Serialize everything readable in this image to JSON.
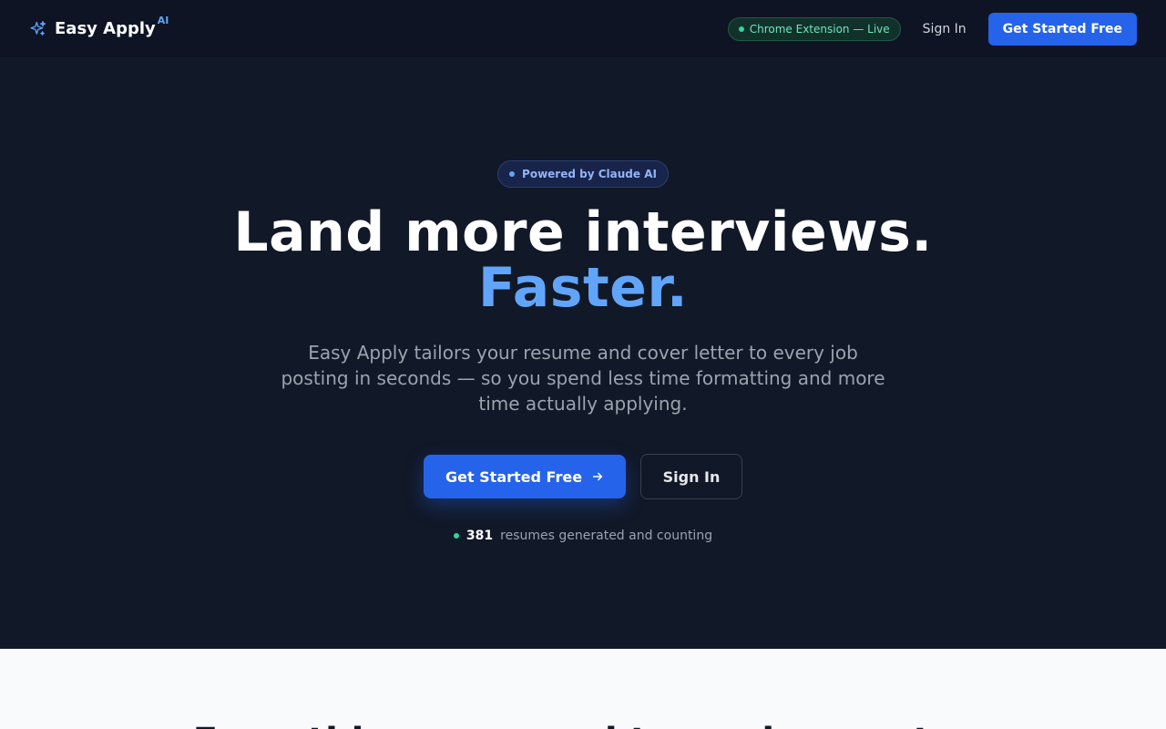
{
  "nav": {
    "brand_name": "Easy Apply",
    "brand_badge": "AI",
    "brand_icon": "sparkles-icon",
    "extension_status": "Chrome Extension — Live",
    "sign_in": "Sign In",
    "cta": "Get Started Free"
  },
  "hero": {
    "badge": "Powered by Claude AI",
    "headline": "Land more interviews.",
    "headline_accent": "Faster.",
    "subcopy": "Easy Apply tailors your resume and cover letter to every job posting in seconds — so you spend less time formatting and more time actually applying.",
    "primary_cta": "Get Started Free",
    "primary_cta_icon": "arrow-right-icon",
    "secondary_cta": "Sign In",
    "counter_value": "381",
    "counter_text": "resumes generated and counting"
  },
  "features": {
    "title": "Everything you need to apply smarter"
  },
  "colors": {
    "background": "#111827",
    "nav_background": "#0e1424",
    "accent": "#2563eb",
    "accent_text": "#60a5fa",
    "live_green": "#34d399",
    "features_background": "#f8fafc"
  }
}
